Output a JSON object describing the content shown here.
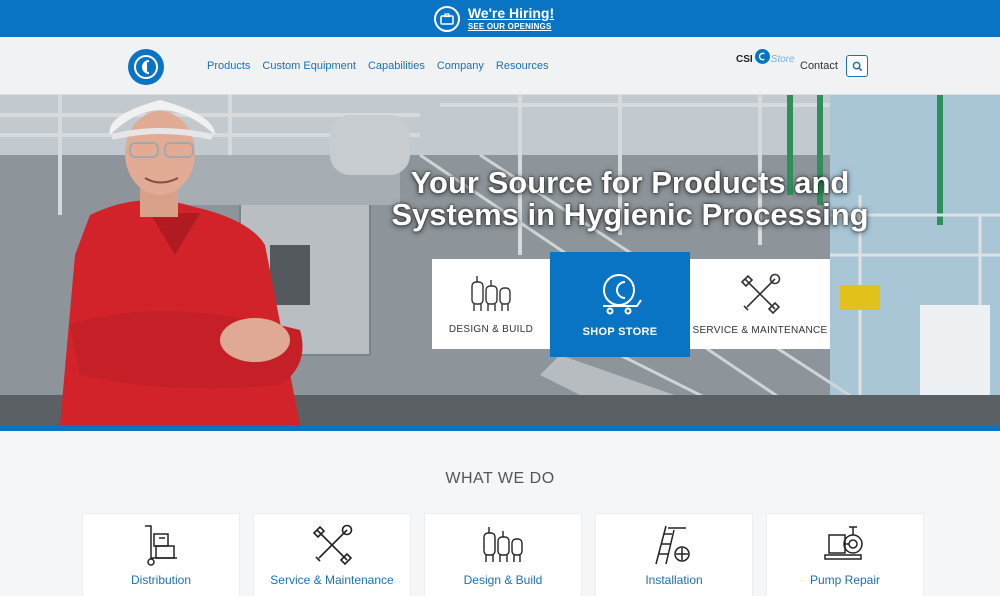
{
  "banner": {
    "title": "We're Hiring!",
    "subtitle": "SEE OUR OPENINGS",
    "icon": "briefcase-icon"
  },
  "header": {
    "logo": "csi-logo",
    "nav": [
      {
        "label": "Products"
      },
      {
        "label": "Custom Equipment"
      },
      {
        "label": "Capabilities"
      },
      {
        "label": "Company"
      },
      {
        "label": "Resources"
      }
    ],
    "store_prefix": "CSI",
    "store_word": "Store",
    "contact": "Contact",
    "search_icon": "search-icon"
  },
  "hero": {
    "title": "Your Source for Products and Systems in Hygienic Processing",
    "cards": [
      {
        "label": "DESIGN & BUILD",
        "icon": "tanks-icon"
      },
      {
        "label": "SHOP STORE",
        "icon": "store-cart-icon"
      },
      {
        "label": "SERVICE & MAINTENANCE",
        "icon": "tools-icon"
      }
    ]
  },
  "what_we_do": {
    "title": "WHAT WE DO",
    "services": [
      {
        "label": "Distribution",
        "icon": "hand-truck-icon"
      },
      {
        "label": "Service & Maintenance",
        "icon": "tools-icon"
      },
      {
        "label": "Design & Build",
        "icon": "tanks-icon"
      },
      {
        "label": "Installation",
        "icon": "ladder-icon"
      },
      {
        "label": "Pump Repair",
        "icon": "pump-icon"
      }
    ]
  },
  "colors": {
    "brand_blue": "#0a74c4",
    "nav_blue": "#1c6fb8",
    "polo_red": "#d2232a"
  }
}
